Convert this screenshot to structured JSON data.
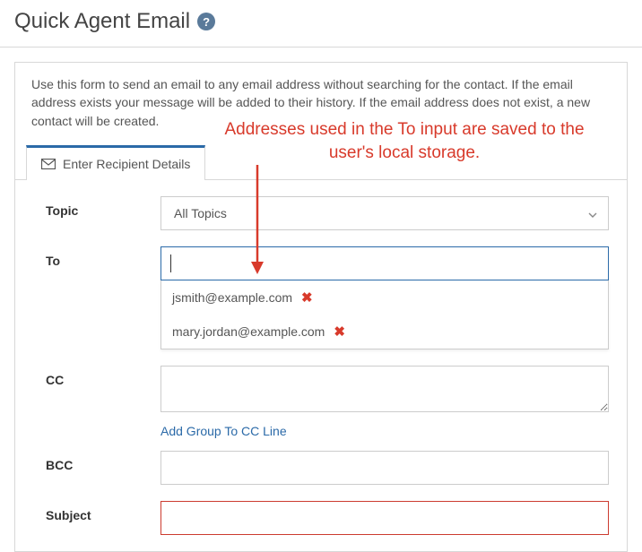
{
  "header": {
    "title": "Quick Agent Email"
  },
  "intro": "Use this form to send an email to any email address without searching for the contact. If the email address exists your message will be added to their history. If the email address does not exist, a new contact will be created.",
  "tab": {
    "label": "Enter Recipient Details"
  },
  "form": {
    "topic": {
      "label": "Topic",
      "value": "All Topics"
    },
    "to": {
      "label": "To",
      "value": "",
      "suggestions": [
        {
          "email": "jsmith@example.com"
        },
        {
          "email": "mary.jordan@example.com"
        }
      ]
    },
    "cc": {
      "label": "CC",
      "value": "",
      "add_group": "Add Group To CC Line"
    },
    "bcc": {
      "label": "BCC",
      "value": ""
    },
    "subject": {
      "label": "Subject",
      "value": ""
    }
  },
  "annotation": "Addresses used in the To input are saved to the user's local storage."
}
